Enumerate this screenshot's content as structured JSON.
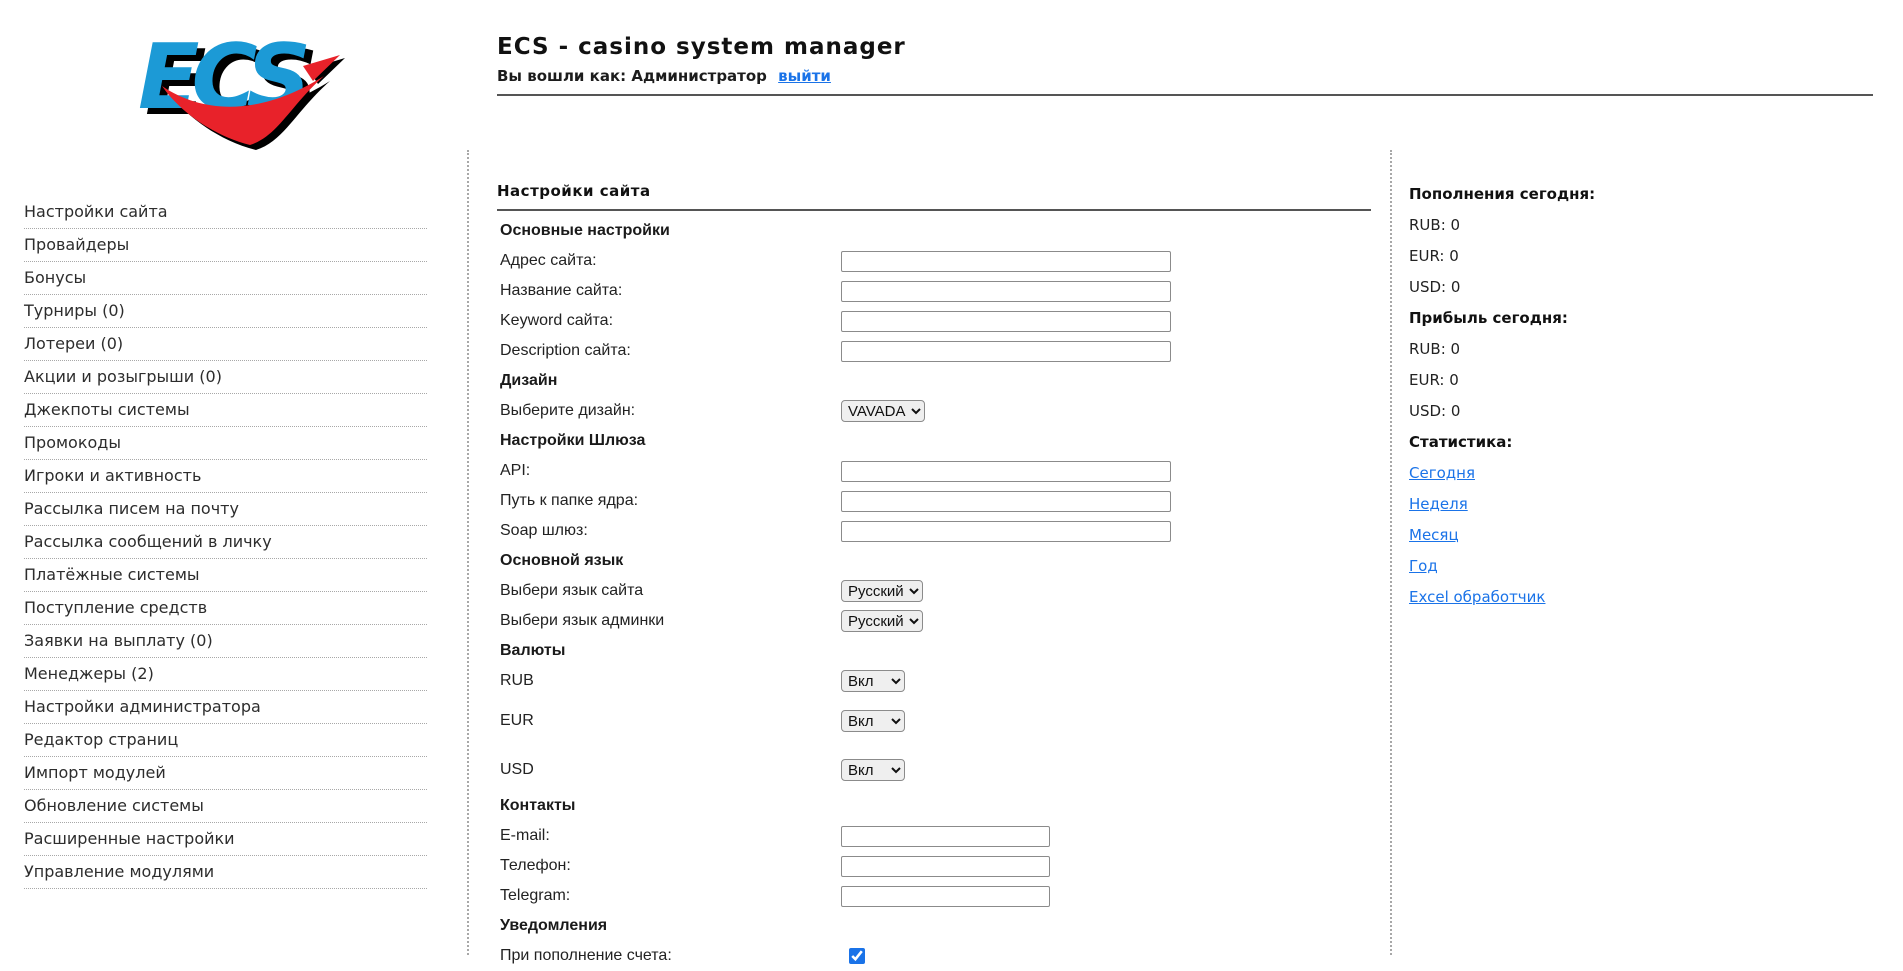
{
  "header": {
    "logo_text": "ECS",
    "title": "ECS - casino system manager",
    "login_prefix": "Вы вошли как: Администратор",
    "logout_label": "выйти"
  },
  "sidebar": {
    "items": [
      {
        "label": "Настройки сайта"
      },
      {
        "label": "Провайдеры"
      },
      {
        "label": "Бонусы"
      },
      {
        "label": "Турниры (0)"
      },
      {
        "label": "Лотереи (0)"
      },
      {
        "label": "Акции и розыгрыши (0)"
      },
      {
        "label": "Джекпоты системы"
      },
      {
        "label": "Промокоды"
      },
      {
        "label": "Игроки и активность"
      },
      {
        "label": "Рассылка писем на почту"
      },
      {
        "label": "Рассылка сообщений в личку"
      },
      {
        "label": "Платёжные системы"
      },
      {
        "label": "Поступление средств"
      },
      {
        "label": "Заявки на выплату (0)"
      },
      {
        "label": "Менеджеры (2)"
      },
      {
        "label": "Настройки администратора"
      },
      {
        "label": "Редактор страниц"
      },
      {
        "label": "Импорт модулей"
      },
      {
        "label": "Обновление системы"
      },
      {
        "label": "Расширенные настройки"
      },
      {
        "label": "Управление модулями"
      }
    ]
  },
  "main": {
    "title": "Настройки сайта",
    "rows": [
      {
        "type": "section",
        "name": "basic-settings",
        "label": "Основные настройки"
      },
      {
        "type": "field",
        "name": "site-address",
        "label": "Адрес сайта:",
        "control": "input",
        "value": "",
        "size": "long"
      },
      {
        "type": "field",
        "name": "site-name",
        "label": "Название сайта:",
        "control": "input",
        "value": "",
        "size": "long"
      },
      {
        "type": "field",
        "name": "site-keyword",
        "label": "Keyword сайта:",
        "control": "input",
        "value": "",
        "size": "long"
      },
      {
        "type": "field",
        "name": "site-description",
        "label": "Description сайта:",
        "control": "input",
        "value": "",
        "size": "long"
      },
      {
        "type": "section",
        "name": "design",
        "label": "Дизайн"
      },
      {
        "type": "field",
        "name": "design-choice",
        "label": "Выберите дизайн:",
        "control": "select",
        "value": "VAVADA"
      },
      {
        "type": "section",
        "name": "gateway-settings",
        "label": "Настройки Шлюза"
      },
      {
        "type": "field",
        "name": "api",
        "label": "API:",
        "control": "input",
        "value": "",
        "size": "long"
      },
      {
        "type": "field",
        "name": "core-folder-path",
        "label": "Путь к папке ядра:",
        "control": "input",
        "value": "",
        "size": "long"
      },
      {
        "type": "field",
        "name": "soap-gateway",
        "label": "Soap шлюз:",
        "control": "input",
        "value": "",
        "size": "long"
      },
      {
        "type": "section",
        "name": "main-language",
        "label": "Основной язык"
      },
      {
        "type": "field",
        "name": "site-language",
        "label": "Выбери язык сайта",
        "control": "select",
        "value": "Русский"
      },
      {
        "type": "field",
        "name": "admin-language",
        "label": "Выбери язык админки",
        "control": "select",
        "value": "Русский"
      },
      {
        "type": "section",
        "name": "currencies",
        "label": "Валюты"
      },
      {
        "type": "field",
        "name": "currency-rub",
        "label": "RUB",
        "control": "select",
        "value": "Вкл"
      },
      {
        "type": "field",
        "name": "currency-eur",
        "label": "EUR",
        "control": "select",
        "value": "Вкл",
        "gap": "m"
      },
      {
        "type": "field",
        "name": "currency-usd",
        "label": "USD",
        "control": "select",
        "value": "Вкл",
        "gap": "l"
      },
      {
        "type": "section",
        "name": "contacts",
        "label": "Контакты",
        "gap": "s"
      },
      {
        "type": "field",
        "name": "email",
        "label": "E-mail:",
        "control": "input",
        "value": "",
        "size": "short"
      },
      {
        "type": "field",
        "name": "phone",
        "label": "Телефон:",
        "control": "input",
        "value": "",
        "size": "short"
      },
      {
        "type": "field",
        "name": "telegram",
        "label": "Telegram:",
        "control": "input",
        "value": "",
        "size": "short"
      },
      {
        "type": "section",
        "name": "notifications",
        "label": "Уведомления"
      },
      {
        "type": "field",
        "name": "notify-on-deposit",
        "label": "При пополнение счета:",
        "control": "checkbox",
        "checked": true
      }
    ]
  },
  "right_panel": {
    "items": [
      {
        "type": "header",
        "name": "deposits-today-header",
        "text": "Пополнения сегодня:"
      },
      {
        "type": "value",
        "name": "deposits-rub",
        "text": "RUB: 0"
      },
      {
        "type": "value",
        "name": "deposits-eur",
        "text": "EUR: 0"
      },
      {
        "type": "value",
        "name": "deposits-usd",
        "text": "USD: 0"
      },
      {
        "type": "header",
        "name": "profit-today-header",
        "text": "Прибыль сегодня:"
      },
      {
        "type": "value",
        "name": "profit-rub",
        "text": "RUB: 0"
      },
      {
        "type": "value",
        "name": "profit-eur",
        "text": "EUR: 0"
      },
      {
        "type": "value",
        "name": "profit-usd",
        "text": "USD: 0"
      },
      {
        "type": "header",
        "name": "statistics-header",
        "text": "Статистика:"
      },
      {
        "type": "link",
        "name": "stats-today-link",
        "text": "Сегодня"
      },
      {
        "type": "link",
        "name": "stats-week-link",
        "text": "Неделя"
      },
      {
        "type": "link",
        "name": "stats-month-link",
        "text": "Месяц"
      },
      {
        "type": "link",
        "name": "stats-year-link",
        "text": "Год"
      },
      {
        "type": "link",
        "name": "stats-excel-link",
        "text": "Excel обработчик"
      }
    ]
  },
  "colors": {
    "link_blue": "#1a73e8",
    "logo_blue": "#1c9ad6",
    "logo_red": "#e8222a",
    "rule_gray": "#555555"
  }
}
